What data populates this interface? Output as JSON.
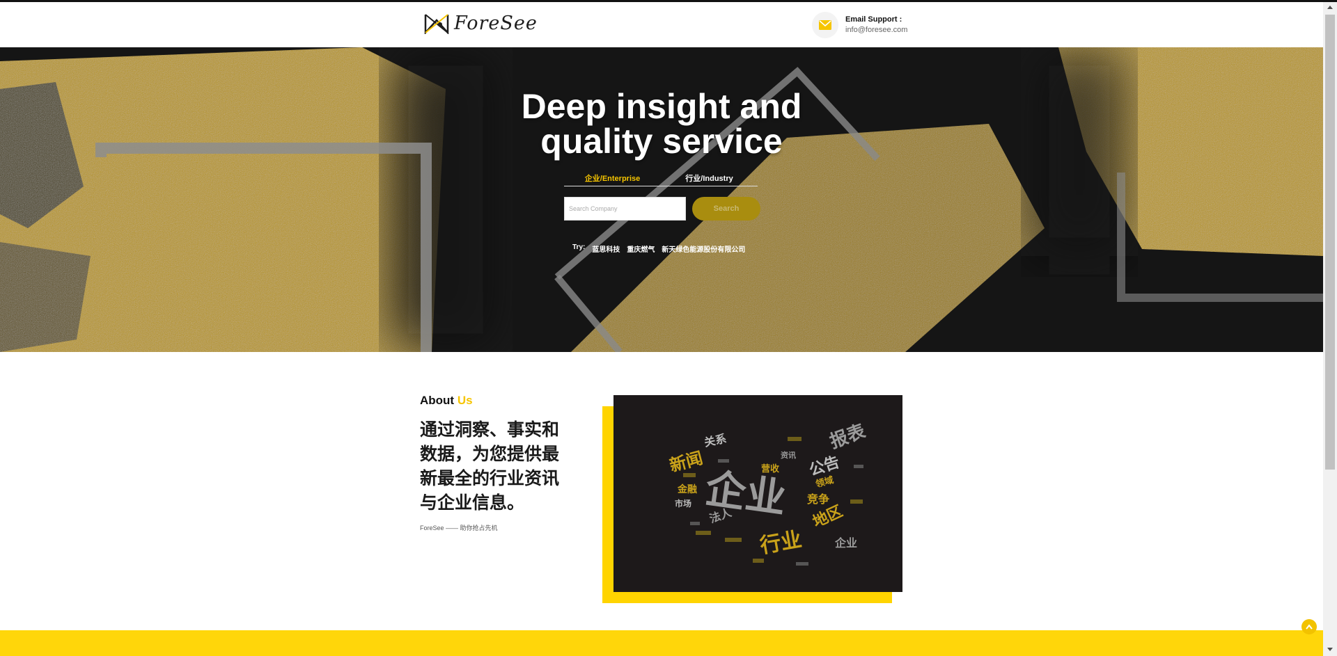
{
  "header": {
    "brand": "ForeSee",
    "email_label": "Email Support :",
    "email_address": "info@foresee.com"
  },
  "hero": {
    "title_line1": "Deep insight and",
    "title_line2": "quality service",
    "tabs": [
      {
        "label": "企业/Enterprise",
        "active": true
      },
      {
        "label": "行业/Industry",
        "active": false
      }
    ],
    "search_placeholder": "Search Company",
    "search_button": "Search",
    "try_label": "Try:",
    "try_links": [
      "蓝思科技",
      "重庆燃气",
      "新天绿色能源股份有限公司"
    ]
  },
  "about": {
    "heading_main": "About",
    "heading_accent": "Us",
    "body": "通过洞察、事实和数据，为您提供最新最全的行业资讯与企业信息。",
    "subline": "ForeSee —— 助你抢占先机",
    "word_cloud_words": [
      "企业",
      "行业",
      "新闻",
      "报表",
      "公告",
      "地区",
      "关系",
      "竞争",
      "法人",
      "金融",
      "市场",
      "领域",
      "营收",
      "资讯",
      "企业"
    ]
  },
  "colors": {
    "accent_yellow": "#f6c500",
    "band_yellow": "#ffd60a",
    "hero_dark": "#1a1a1a",
    "cloud_bg": "#1d191a"
  },
  "icons": {
    "mail": "envelope-icon",
    "back_to_top": "chevron-up-icon"
  }
}
